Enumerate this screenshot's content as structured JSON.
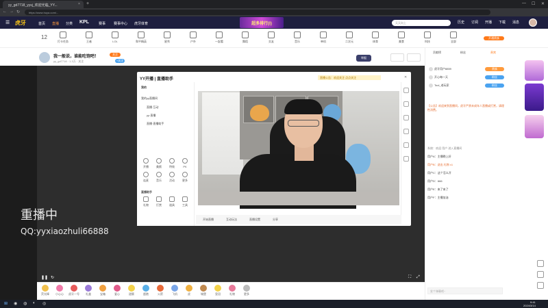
{
  "browser": {
    "tab_title": "yy_gd7718_yysj_欢迎光临_YY...",
    "url": "https://www.huya.com/...",
    "close": "×",
    "new_tab": "+"
  },
  "site": {
    "logo": "虎牙",
    "nav": [
      "首页",
      "直播",
      "分类",
      "KPL",
      "赛事",
      "赛事中心",
      "虎牙体育"
    ],
    "banner": "超多排行(I)",
    "search_placeholder": "天天向上",
    "header_icons": [
      "历史",
      "订阅",
      "开播",
      "下载",
      "消息"
    ]
  },
  "categories": {
    "count": "12",
    "items": [
      "打卡任务",
      "王者",
      "LOL",
      "和平精英",
      "星秀",
      "户外",
      "一起看",
      "舞蹈",
      "交友",
      "音乐",
      "单机",
      "二次元",
      "体育",
      "美食",
      "科技",
      "全部"
    ],
    "right_button": "开通贵族"
  },
  "room": {
    "title": "我一般说，谁能吃饱吧！",
    "subtitle": "yy_gd7718 · 1.3万 · 关注",
    "badge": "关注",
    "follow": "+关注",
    "report": "举报"
  },
  "sidebar": {
    "tabs": [
      "贡献榜",
      "粉丝",
      "贵宾"
    ],
    "ranks": [
      {
        "name": "虎牙用户8859",
        "badge": "贵族"
      },
      {
        "name": "开心每一天",
        "badge": "粉丝"
      },
      {
        "name": "Tool_老玩家",
        "badge": "粉丝"
      }
    ],
    "chat": [
      "【公告】欢迎来到直播间，虎牙严禁未成年人直播或打赏，请理性消费。",
      "系统：欢迎 用户 进入直播间",
      "用户A：主播晚上好",
      "用户B：送出 礼物 x1",
      "用户C：这个怎么开",
      "用户D：666",
      "用户E：来了来了",
      "用户F：主播加油"
    ],
    "chat_placeholder": "发个弹幕吧~"
  },
  "player": {
    "overlay_title": "重播中",
    "overlay_sub": "QQ:yyxiaozhuli66888"
  },
  "yy_app": {
    "title": "YY开播 | 直播助手",
    "notice": "直播公告：欢迎关注 点点关注",
    "list_header": "我的",
    "list_items": [
      "我的yy直播间",
      "直播·互动",
      "yy·直播",
      "直播·直播助手"
    ],
    "grid": [
      "开播",
      "美颜",
      "特效",
      "PK",
      "连麦",
      "音乐",
      "活动",
      "更多"
    ],
    "section": "直播助手",
    "tools": [
      "礼物",
      "打赏",
      "道具",
      "工具"
    ],
    "toolbar": [
      "开始直播",
      "互动玩法",
      "直播设置",
      "分享"
    ]
  },
  "gifts": [
    "荧光棒",
    "小心心",
    "虎牙一号",
    "礼盒",
    "宝箱",
    "爱心",
    "甜蜜",
    "超跑",
    "火箭",
    "飞机",
    "虎",
    "城堡",
    "皇冠",
    "礼物",
    "更多"
  ],
  "colors": {
    "accent": "#ff7a1a",
    "header_bg": "#1e1f3f",
    "player_bg": "#2d2d2d"
  },
  "taskbar": {
    "time": "9:41",
    "date": "2024/3/14"
  }
}
